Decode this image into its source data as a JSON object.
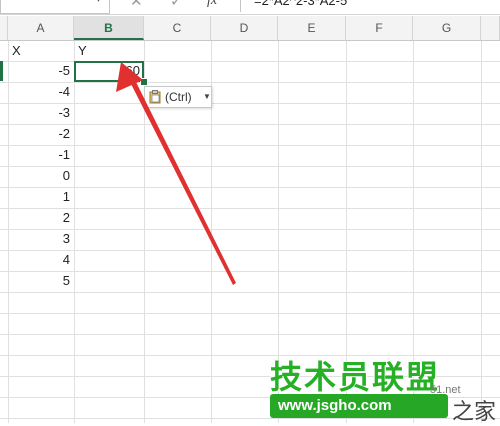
{
  "formula_bar": {
    "name_box_value": "",
    "fx_label": "fx",
    "formula_text": "=2*A2^2-3*A2-5"
  },
  "columns": [
    "A",
    "B",
    "C",
    "D",
    "E",
    "F",
    "G"
  ],
  "selected_column": "B",
  "sheet": {
    "header_row": {
      "a": "X",
      "b": "Y"
    },
    "x_values": [
      "-5",
      "-4",
      "-3",
      "-2",
      "-1",
      "0",
      "1",
      "2",
      "3",
      "4",
      "5"
    ],
    "active_cell_value": "60"
  },
  "paste_options": {
    "label": "(Ctrl)"
  },
  "watermark": {
    "chinese_text": "技术员联盟",
    "url": "www.jsgho.com",
    "tld": "51.net",
    "suffix": "之家"
  },
  "colors": {
    "accent": "#217346",
    "arrow": "#e0302f",
    "watermark_green": "#26a826"
  }
}
